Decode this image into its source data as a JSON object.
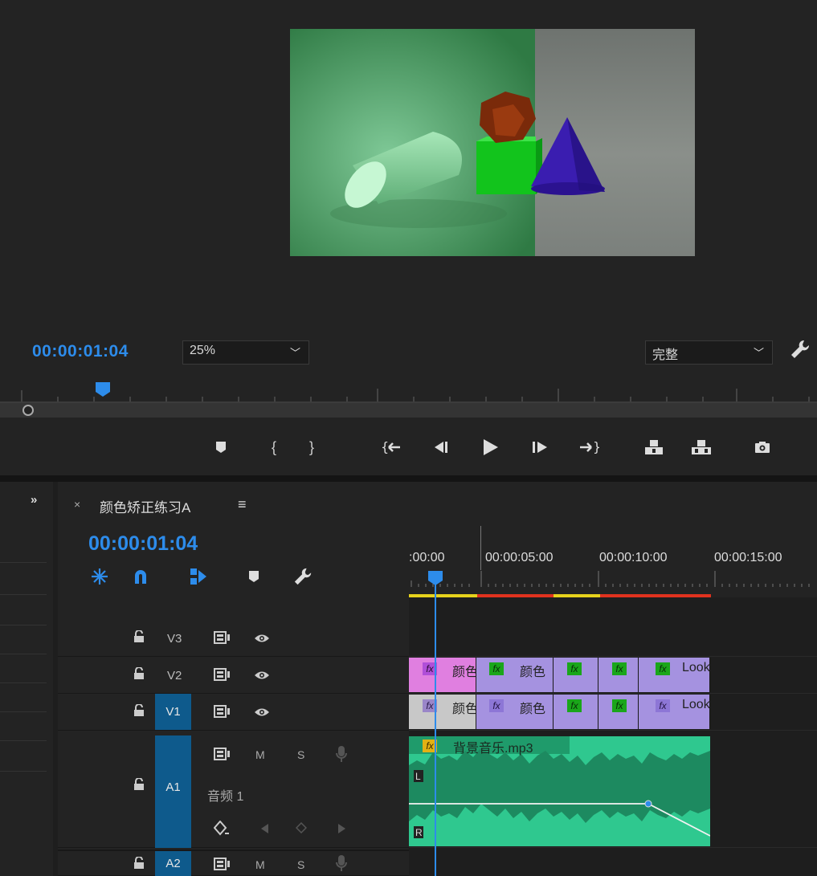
{
  "program_monitor": {
    "timecode": "00:00:01:04",
    "zoom": "25%",
    "quality": "完整",
    "transport_buttons": [
      {
        "name": "add-marker",
        "glyph": "⬟"
      },
      {
        "name": "mark-in",
        "glyph": "{"
      },
      {
        "name": "mark-out",
        "glyph": "}"
      },
      {
        "name": "go-to-in",
        "glyph": "{←"
      },
      {
        "name": "step-back",
        "glyph": "◀❙"
      },
      {
        "name": "play",
        "glyph": "▶"
      },
      {
        "name": "step-forward",
        "glyph": "❙▶"
      },
      {
        "name": "go-to-out",
        "glyph": "→}"
      },
      {
        "name": "lift",
        "glyph": "⏏"
      },
      {
        "name": "extract",
        "glyph": "⏏"
      },
      {
        "name": "export-frame",
        "glyph": "📷"
      }
    ]
  },
  "sequence": {
    "tab_close": "×",
    "title": "颜色矫正练习A",
    "menu": "≡",
    "timecode": "00:00:01:04",
    "ruler_labels": [
      ":00:00",
      "00:00:05:00",
      "00:00:10:00",
      "00:00:15:00"
    ],
    "expand_panels": "»"
  },
  "tracks": {
    "V3": {
      "label": "V3"
    },
    "V2": {
      "label": "V2"
    },
    "V1": {
      "label": "V1"
    },
    "A1": {
      "label": "A1",
      "name": "音频 1",
      "m": "M",
      "s": "S"
    },
    "A2": {
      "label": "A2",
      "m": "M",
      "s": "S"
    }
  },
  "clips": {
    "v2": [
      {
        "label": "颜色",
        "color": "#e07fe0"
      },
      {
        "label": "颜色",
        "color": "#a592e0"
      },
      {
        "label": "",
        "color": "#a592e0"
      },
      {
        "label": "",
        "color": "#a592e0"
      },
      {
        "label": "Look",
        "color": "#a592e0"
      }
    ],
    "v1": [
      {
        "label": "颜色",
        "color": "#c8c8c8"
      },
      {
        "label": "颜色",
        "color": "#a592e0"
      },
      {
        "label": "",
        "color": "#a592e0"
      },
      {
        "label": "",
        "color": "#a592e0"
      },
      {
        "label": "Look",
        "color": "#a592e0"
      }
    ],
    "audio": {
      "label": "背景音乐.mp3",
      "color": "#2fc88f",
      "channel_l": "L",
      "channel_r": "R"
    }
  },
  "fx_badge": "fx"
}
